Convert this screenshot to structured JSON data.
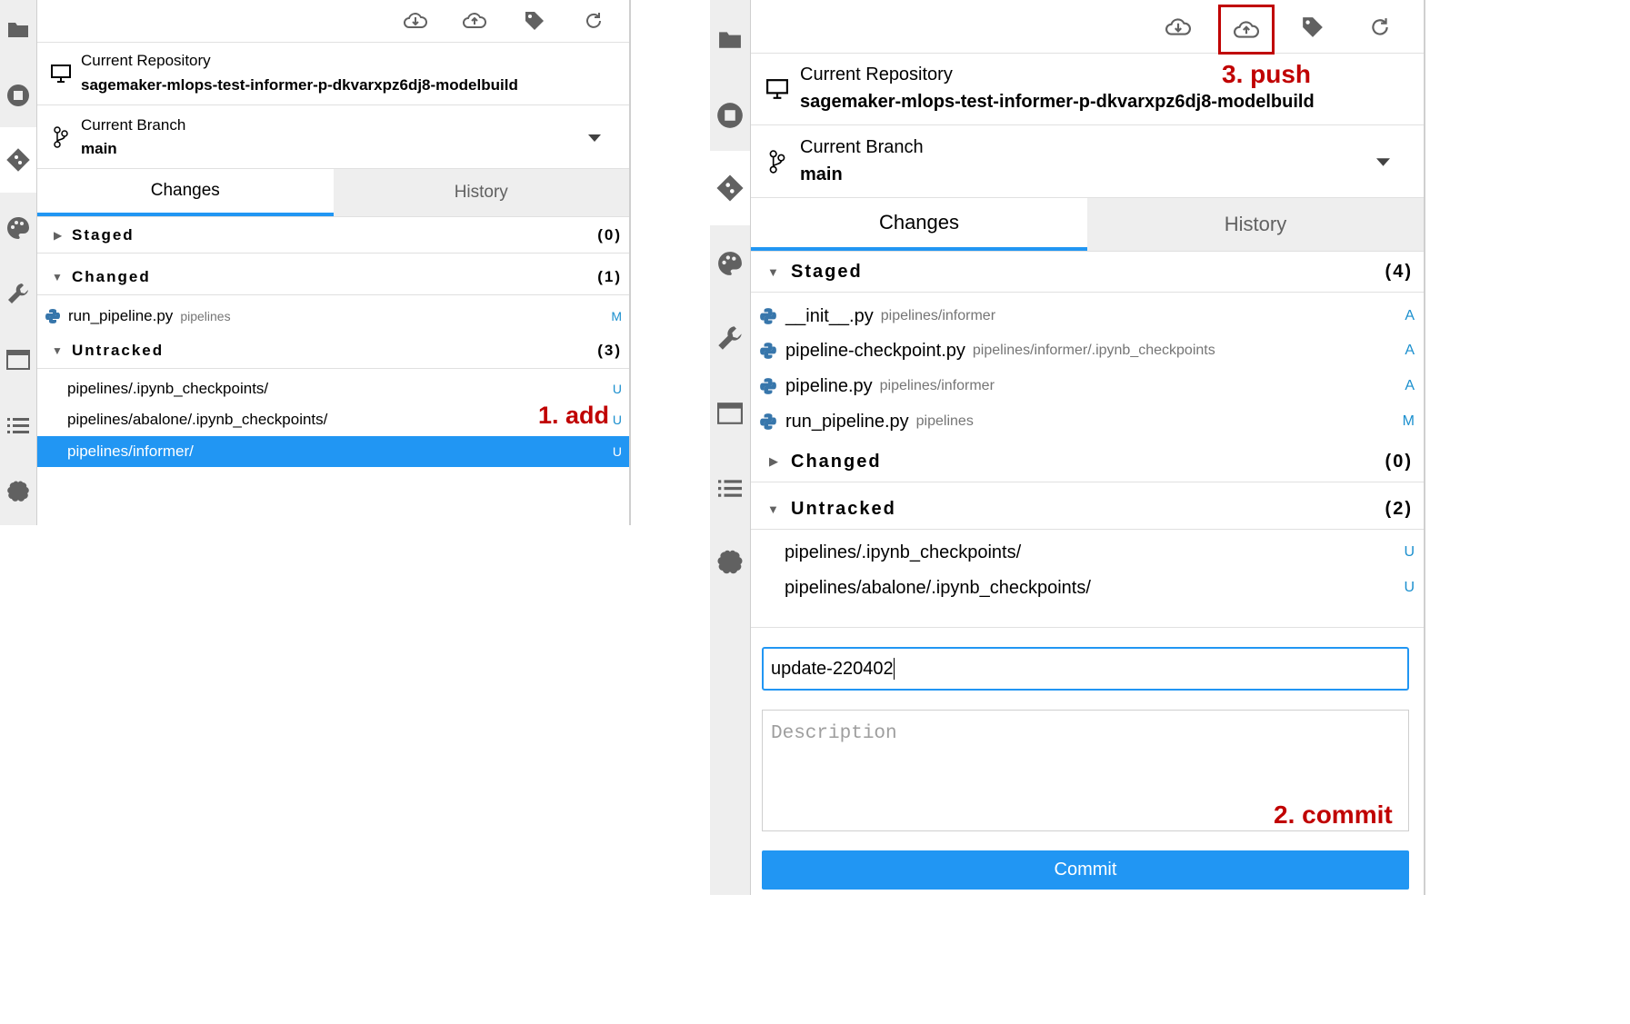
{
  "left": {
    "toolbar": {
      "icons": [
        "cloud-download-icon",
        "cloud-upload-icon",
        "tag-icon",
        "refresh-icon"
      ]
    },
    "repo": {
      "label": "Current Repository",
      "name": "sagemaker-mlops-test-informer-p-dkvarxpz6dj8-modelbuild"
    },
    "branch": {
      "label": "Current Branch",
      "name": "main"
    },
    "tabs": {
      "changes": "Changes",
      "history": "History"
    },
    "staged": {
      "label": "Staged",
      "count": "(0)"
    },
    "changed": {
      "label": "Changed",
      "count": "(1)",
      "files": [
        {
          "name": "run_pipeline.py",
          "path": "pipelines",
          "status": "M"
        }
      ]
    },
    "untracked": {
      "label": "Untracked",
      "count": "(3)",
      "files": [
        {
          "name": "pipelines/.ipynb_checkpoints/",
          "status": "U"
        },
        {
          "name": "pipelines/abalone/.ipynb_checkpoints/",
          "status": "U"
        },
        {
          "name": "pipelines/informer/",
          "status": "U"
        }
      ]
    },
    "annotation": "1. add"
  },
  "right": {
    "toolbar": {
      "icons": [
        "cloud-download-icon",
        "cloud-upload-icon",
        "tag-icon",
        "refresh-icon"
      ]
    },
    "annotation_push": "3. push",
    "repo": {
      "label": "Current Repository",
      "name": "sagemaker-mlops-test-informer-p-dkvarxpz6dj8-modelbuild"
    },
    "branch": {
      "label": "Current Branch",
      "name": "main"
    },
    "tabs": {
      "changes": "Changes",
      "history": "History"
    },
    "staged": {
      "label": "Staged",
      "count": "(4)",
      "files": [
        {
          "name": "__init__.py",
          "path": "pipelines/informer",
          "status": "A"
        },
        {
          "name": "pipeline-checkpoint.py",
          "path": "pipelines/informer/.ipynb_checkpoints",
          "status": "A"
        },
        {
          "name": "pipeline.py",
          "path": "pipelines/informer",
          "status": "A"
        },
        {
          "name": "run_pipeline.py",
          "path": "pipelines",
          "status": "M"
        }
      ]
    },
    "changed": {
      "label": "Changed",
      "count": "(0)"
    },
    "untracked": {
      "label": "Untracked",
      "count": "(2)",
      "files": [
        {
          "name": "pipelines/.ipynb_checkpoints/",
          "status": "U"
        },
        {
          "name": "pipelines/abalone/.ipynb_checkpoints/",
          "status": "U"
        }
      ]
    },
    "commit": {
      "summary_value": "update-220402",
      "description_placeholder": "Description",
      "button": "Commit"
    },
    "annotation_commit": "2. commit"
  },
  "colors": {
    "accent": "#2196f3",
    "annotation": "#c00000",
    "status": "#1a8fce"
  }
}
